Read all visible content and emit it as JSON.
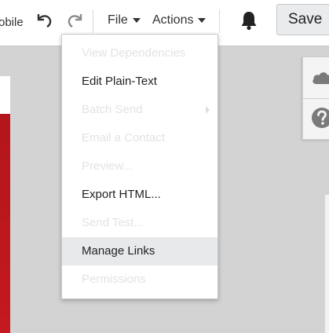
{
  "toolbar": {
    "mobile_label": "obile",
    "file_label": "File",
    "actions_label": "Actions",
    "save_label": "Save"
  },
  "menu": {
    "items": [
      {
        "label": "View Dependencies",
        "enabled": false
      },
      {
        "label": "Edit Plain-Text",
        "enabled": true
      },
      {
        "label": "Batch Send",
        "enabled": false,
        "submenu": true
      },
      {
        "label": "Email a Contact",
        "enabled": false
      },
      {
        "label": "Preview...",
        "enabled": false
      },
      {
        "label": "Export HTML...",
        "enabled": true
      },
      {
        "label": "Send Test...",
        "enabled": false
      },
      {
        "label": "Manage Links",
        "enabled": true,
        "highlighted": true
      },
      {
        "label": "Permissions",
        "enabled": false
      }
    ]
  },
  "icons": {
    "undo": "undo-icon",
    "redo": "redo-icon",
    "notifications": "bell-icon",
    "cloud": "cloud-icon",
    "help": "help-icon"
  },
  "colors": {
    "accent_red": "#c4191f",
    "canvas_gray": "#d3d3d3"
  }
}
